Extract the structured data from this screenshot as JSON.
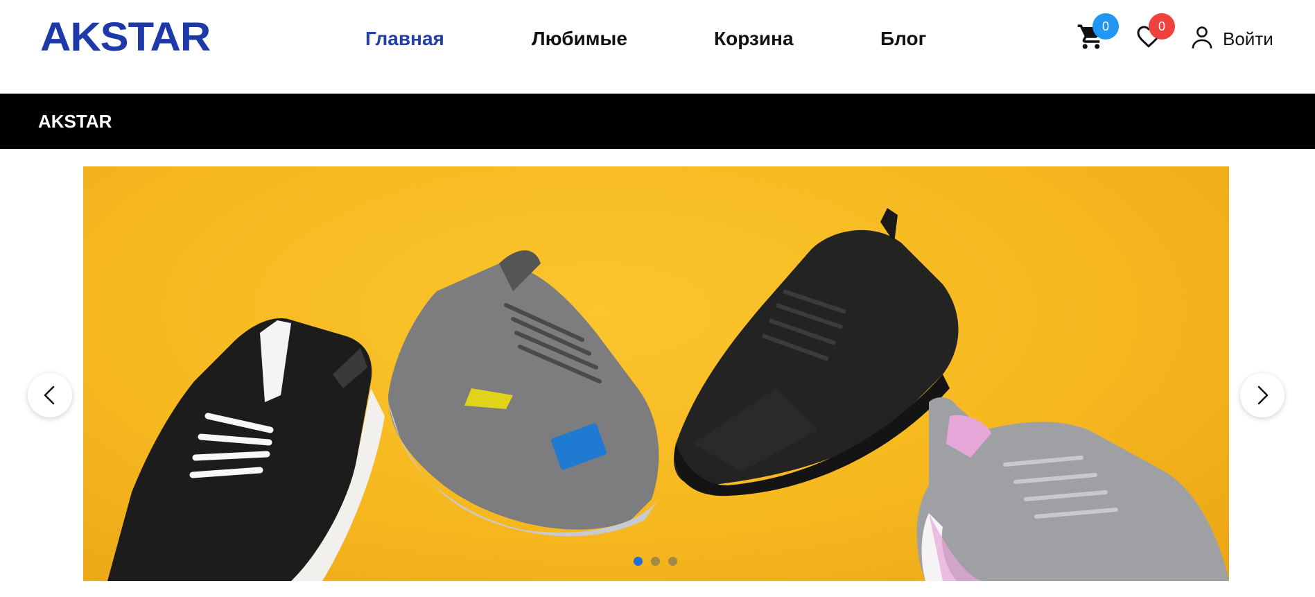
{
  "brand": {
    "logo_text": "AKSTAR",
    "color": "#1e3aa8"
  },
  "nav": {
    "items": [
      {
        "label": "Главная",
        "active": true
      },
      {
        "label": "Любимые",
        "active": false
      },
      {
        "label": "Корзина",
        "active": false
      },
      {
        "label": "Блог",
        "active": false
      }
    ],
    "active_color": "#2440a6"
  },
  "header_actions": {
    "cart": {
      "icon": "cart-icon",
      "count": "0",
      "badge_color": "#2196f3"
    },
    "favorites": {
      "icon": "heart-icon",
      "count": "0",
      "badge_color": "#f0413c"
    },
    "login": {
      "icon": "user-icon",
      "label": "Войти"
    }
  },
  "breadcrumb": {
    "text": "AKSTAR"
  },
  "slider": {
    "background_color": "#f6b81f",
    "slides_count": 3,
    "active_slide": 1,
    "prev_icon": "chevron-left-icon",
    "next_icon": "chevron-right-icon",
    "dot_active_color": "#1f6fe0"
  }
}
